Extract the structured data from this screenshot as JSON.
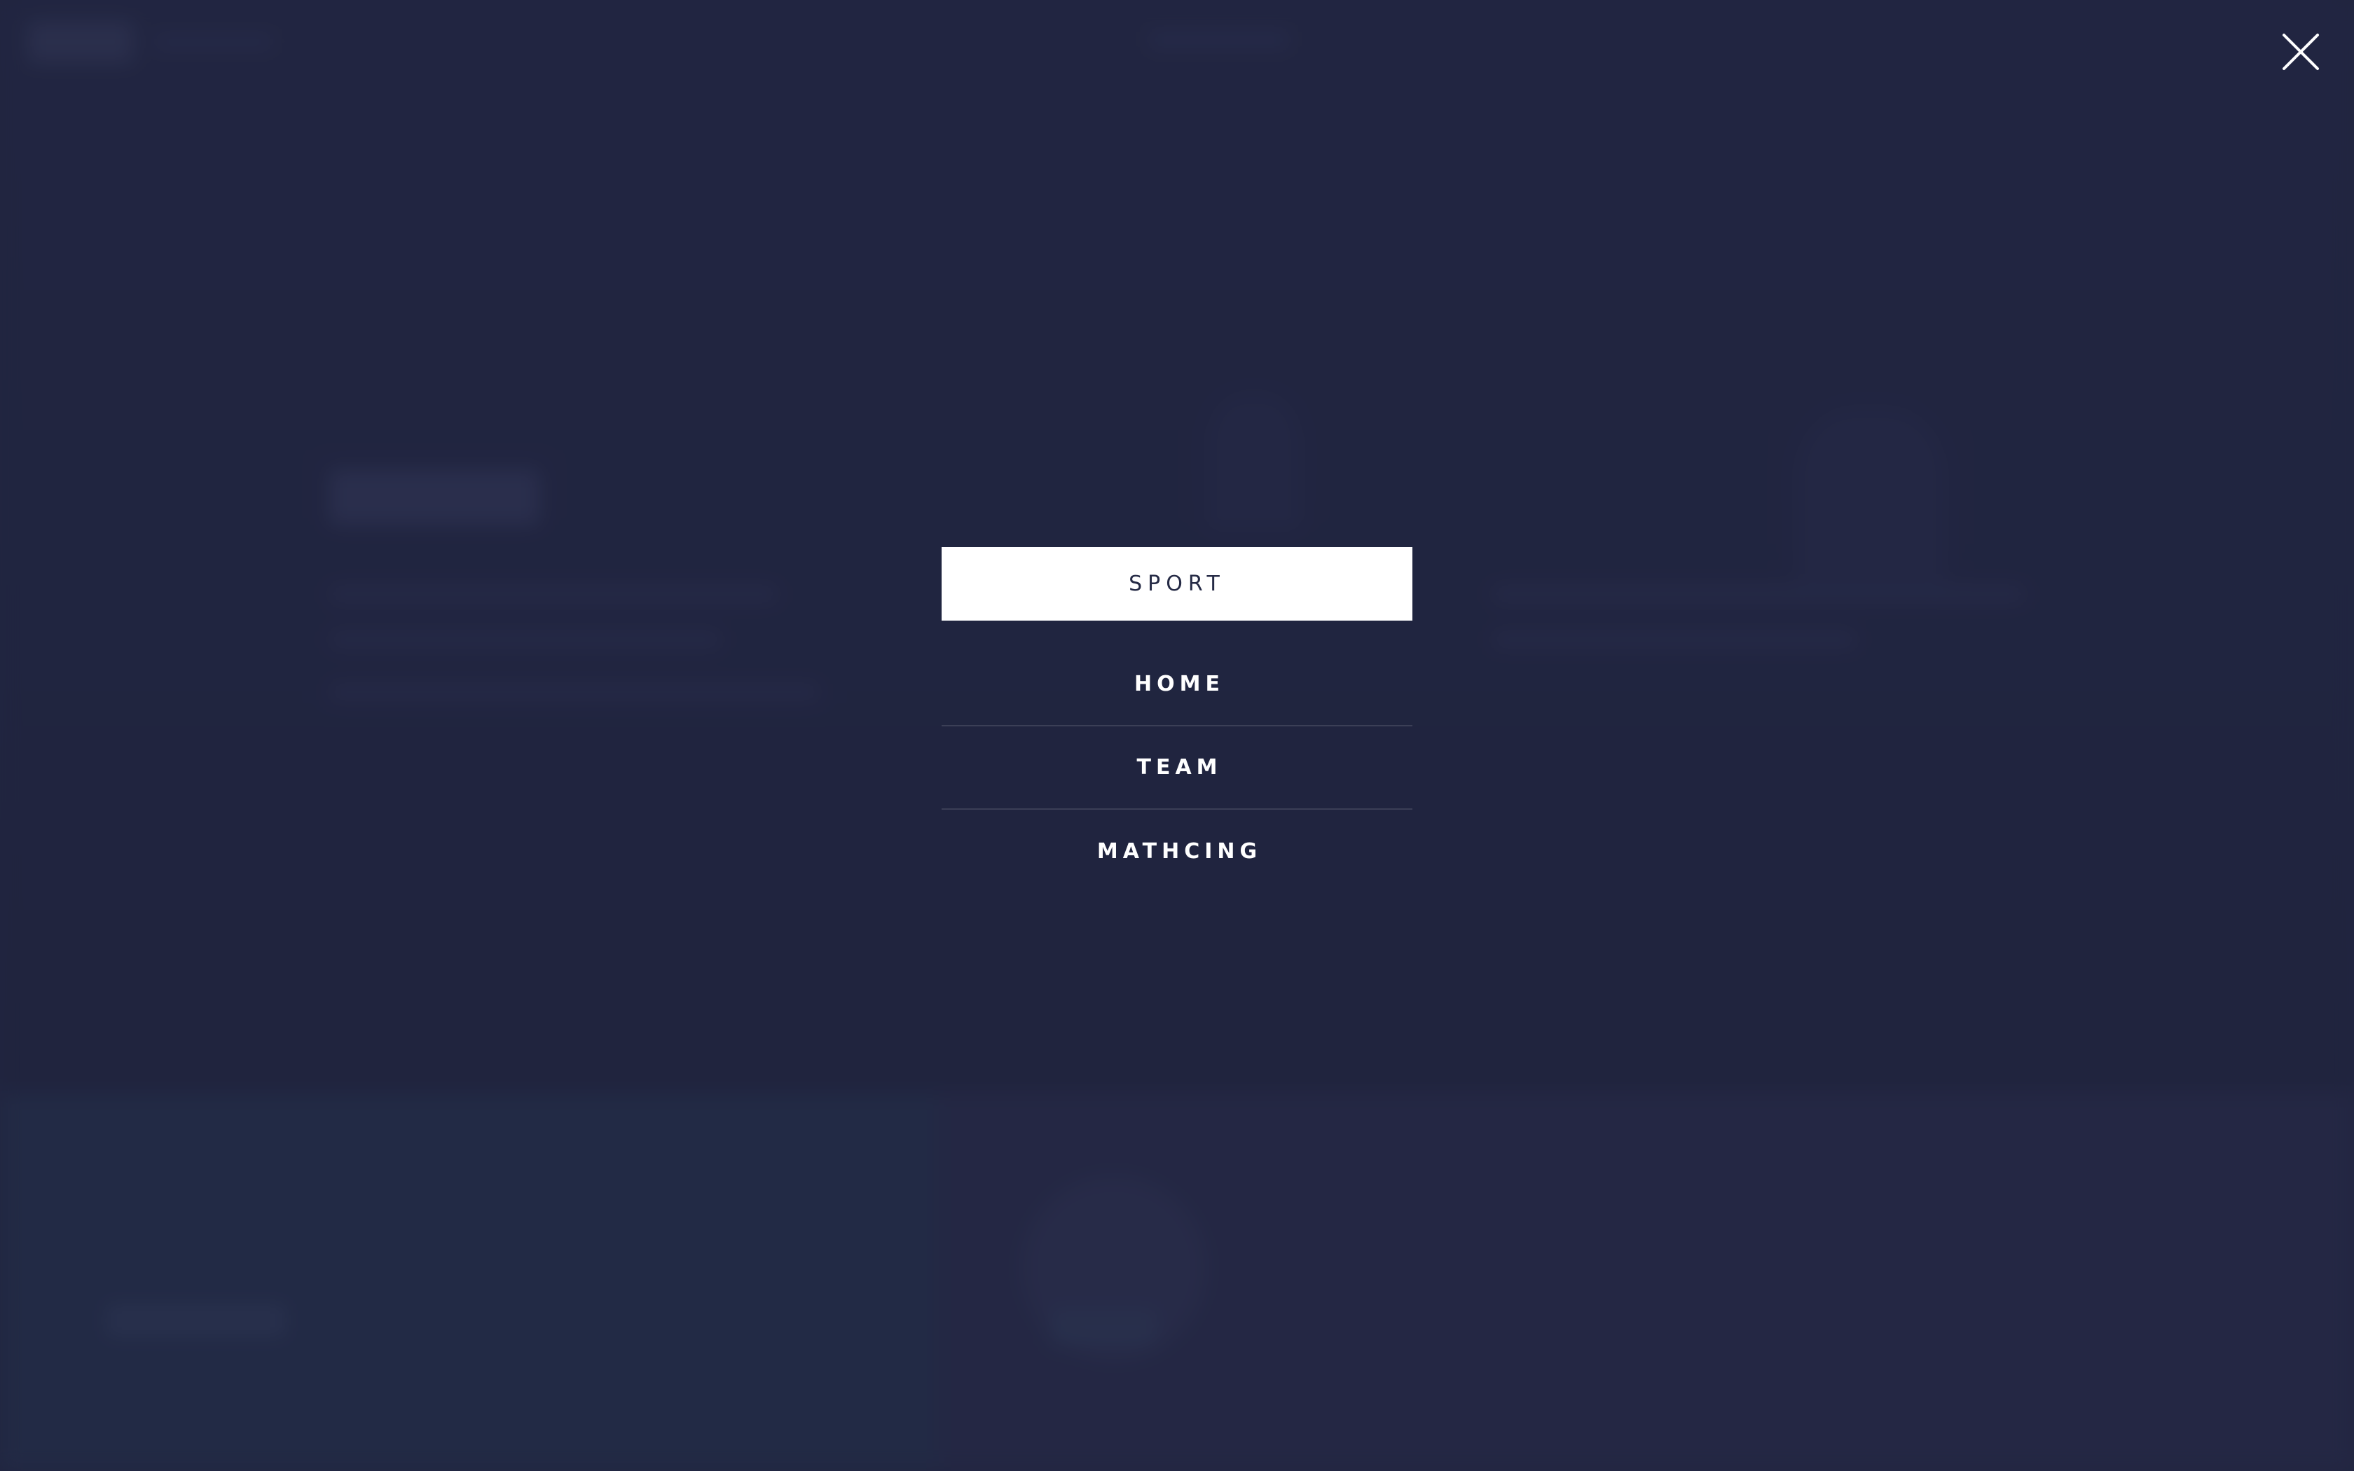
{
  "menu": {
    "header": "SPORT",
    "items": [
      {
        "label": "HOME"
      },
      {
        "label": "TEAM"
      },
      {
        "label": "MATHCING"
      }
    ]
  },
  "icons": {
    "close": "close-icon"
  },
  "colors": {
    "background": "#272b47",
    "menu_header_bg": "#ffffff",
    "menu_header_text": "#252a45",
    "menu_item_text": "#ffffff"
  }
}
